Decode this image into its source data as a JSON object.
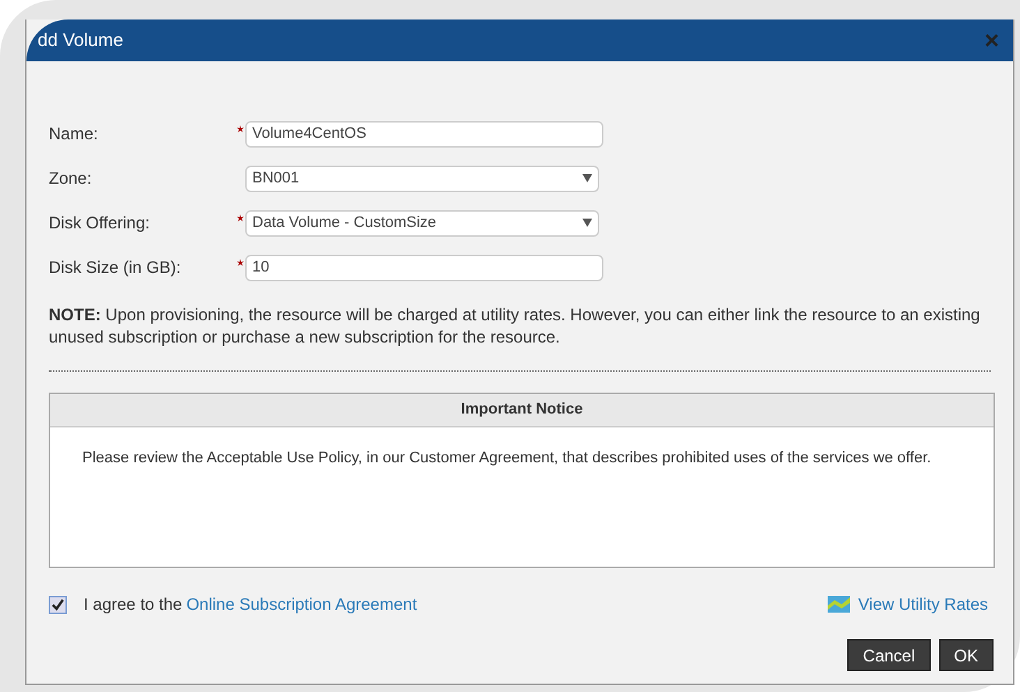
{
  "window": {
    "title": "dd Volume",
    "close": "×"
  },
  "fields": [
    {
      "kind": "text",
      "label": "Name:",
      "required": true,
      "value": "Volume4CentOS"
    },
    {
      "kind": "select",
      "label": "Zone:",
      "required": false,
      "value": "BN001"
    },
    {
      "kind": "select",
      "label": "Disk Offering:",
      "required": true,
      "value": "Data Volume - CustomSize"
    },
    {
      "kind": "text",
      "label": "Disk Size (in GB):",
      "required": true,
      "value": "10"
    }
  ],
  "note": "**NOTE:** Upon provisioning, the resource will be charged at utility rates.  However, you can either link the resource to an existing unused subscription or purchase a new subscription for the resource.",
  "notice": {
    "title": "Important Notice",
    "text": "Please review the Acceptable Use Policy, in our Customer Agreement, that describes prohibited uses of the services we offer."
  },
  "agreement": {
    "checked": true,
    "text": "I agree to the",
    "link": "Online Subscription Agreement"
  },
  "rates_link": "View Utility Rates",
  "buttons": [
    "Cancel",
    "OK"
  ]
}
